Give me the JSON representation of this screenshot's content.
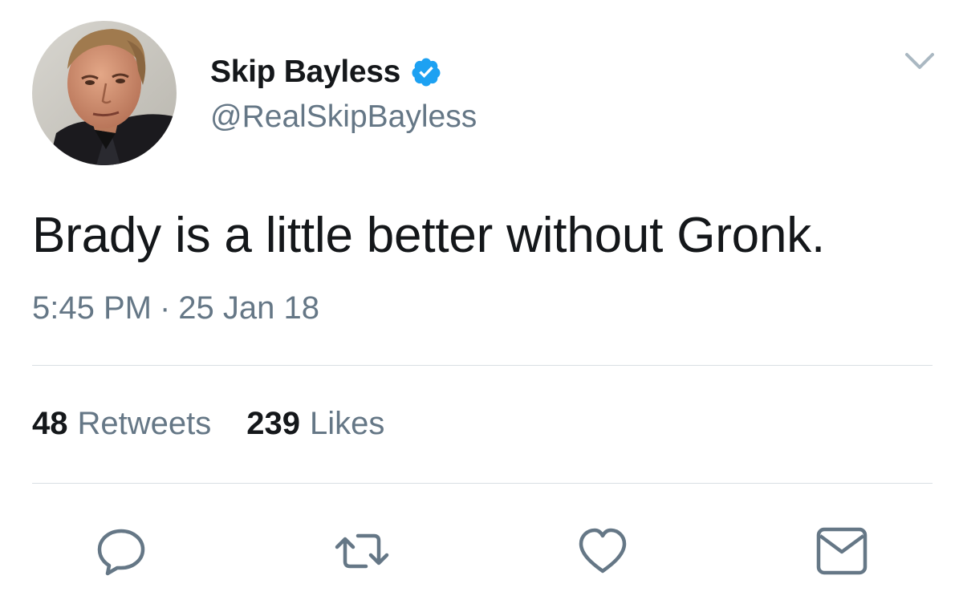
{
  "tweet": {
    "author": {
      "display_name": "Skip Bayless",
      "handle": "@RealSkipBayless",
      "verified": true,
      "avatar": "profile-photo"
    },
    "text": "Brady is a little better without Gronk.",
    "time": "5:45 PM",
    "separator": "·",
    "date": "25 Jan 18",
    "stats": {
      "retweets_count": "48",
      "retweets_label": "Retweets",
      "likes_count": "239",
      "likes_label": "Likes"
    },
    "actions": [
      {
        "name": "reply",
        "icon": "reply-bubble-icon"
      },
      {
        "name": "retweet",
        "icon": "retweet-icon"
      },
      {
        "name": "like",
        "icon": "heart-icon"
      },
      {
        "name": "direct-message",
        "icon": "envelope-icon"
      }
    ]
  },
  "colors": {
    "primary_text": "#14171a",
    "secondary_text": "#657786",
    "verified_blue": "#1da1f2",
    "divider": "#d9dfe4",
    "icon_gray": "#657786"
  }
}
